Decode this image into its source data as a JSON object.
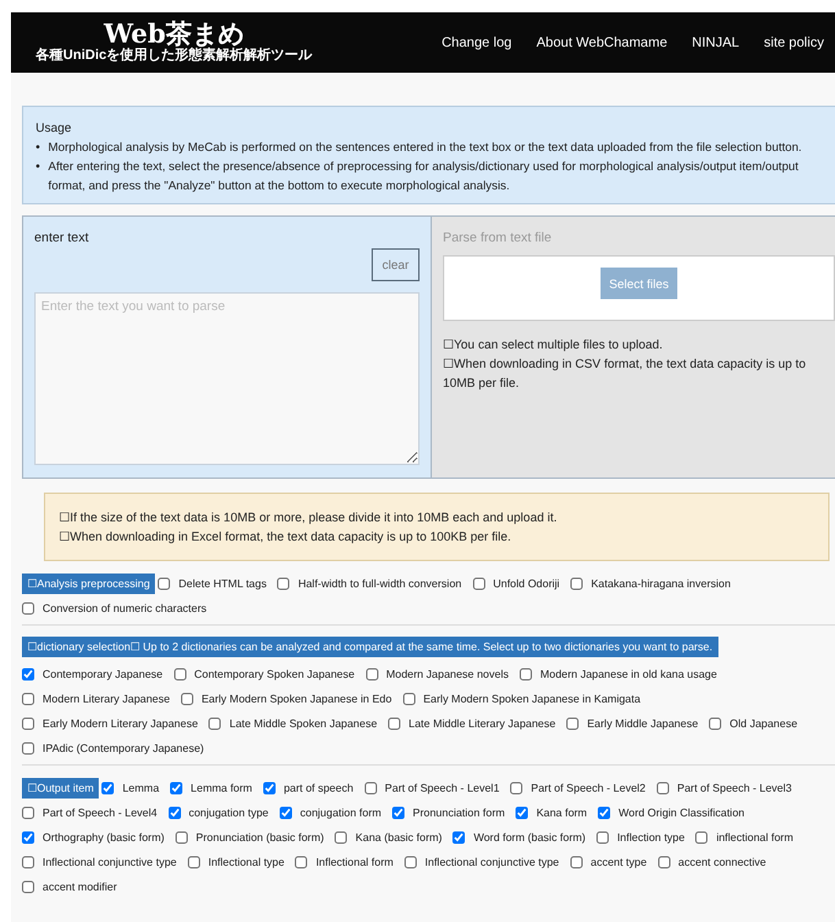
{
  "header": {
    "logo": "Web茶まめ",
    "tagline": "各種UniDicを使用した形態素解析解析ツール",
    "nav": [
      "Change log",
      "About WebChamame",
      "NINJAL",
      "site policy"
    ]
  },
  "usage": {
    "title": "Usage",
    "bullet": "•",
    "items": [
      "Morphological analysis by MeCab is performed on the sentences entered in the text box or the text data uploaded from the file selection button.",
      "After entering the text, select the presence/absence of preprocessing for analysis/dictionary used for morphological analysis/output item/output format, and press the \"Analyze\" button at the bottom to execute morphological analysis."
    ]
  },
  "text_input": {
    "title": "enter text",
    "clear_button": "clear",
    "placeholder": "Enter the text you want to parse"
  },
  "file_input": {
    "title": "Parse from text file",
    "select_button": "Select files",
    "notes": [
      "☐You can select multiple files to upload.",
      "☐When downloading in CSV format, the text data capacity is up to 10MB per file."
    ]
  },
  "notice": [
    "☐If the size of the text data is 10MB or more, please divide it into 10MB each and upload it.",
    "☐When downloading in Excel format, the text data capacity is up to 100KB per file."
  ],
  "sections": [
    {
      "heading": "☐Analysis preprocessing",
      "options": [
        {
          "label": "Delete HTML tags",
          "checked": false
        },
        {
          "label": "Half-width to full-width conversion",
          "checked": false
        },
        {
          "label": "Unfold Odoriji",
          "checked": false
        },
        {
          "label": "Katakana-hiragana inversion",
          "checked": false
        },
        {
          "label": "Conversion of numeric characters",
          "checked": false
        }
      ]
    },
    {
      "heading": "☐dictionary selection☐ Up to 2 dictionaries can be analyzed and compared at the same time. Select up to two dictionaries you want to parse.",
      "options": [
        {
          "label": "Contemporary Japanese",
          "checked": true
        },
        {
          "label": "Contemporary Spoken Japanese",
          "checked": false
        },
        {
          "label": "Modern Japanese novels",
          "checked": false
        },
        {
          "label": "Modern Japanese in old kana usage",
          "checked": false
        },
        {
          "label": "Modern Literary Japanese",
          "checked": false
        },
        {
          "label": "Early Modern Spoken Japanese in Edo",
          "checked": false
        },
        {
          "label": "Early Modern Spoken Japanese in Kamigata",
          "checked": false
        },
        {
          "label": "Early Modern Literary Japanese",
          "checked": false
        },
        {
          "label": "Late Middle Spoken Japanese",
          "checked": false
        },
        {
          "label": "Late Middle Literary Japanese",
          "checked": false
        },
        {
          "label": "Early Middle Japanese",
          "checked": false
        },
        {
          "label": "Old Japanese",
          "checked": false
        },
        {
          "label": "IPAdic (Contemporary Japanese)",
          "checked": false
        }
      ]
    },
    {
      "heading": "☐Output item",
      "options": [
        {
          "label": "Lemma",
          "checked": true
        },
        {
          "label": "Lemma form",
          "checked": true
        },
        {
          "label": "part of speech",
          "checked": true
        },
        {
          "label": "Part of Speech - Level1",
          "checked": false
        },
        {
          "label": "Part of Speech - Level2",
          "checked": false
        },
        {
          "label": "Part of Speech - Level3",
          "checked": false
        },
        {
          "label": "Part of Speech - Level4",
          "checked": false
        },
        {
          "label": "conjugation type",
          "checked": true
        },
        {
          "label": "conjugation form",
          "checked": true
        },
        {
          "label": "Pronunciation form",
          "checked": true
        },
        {
          "label": "Kana form",
          "checked": true
        },
        {
          "label": "Word Origin Classification",
          "checked": true
        },
        {
          "label": "Orthography (basic form)",
          "checked": true
        },
        {
          "label": "Pronunciation (basic form)",
          "checked": false
        },
        {
          "label": "Kana (basic form)",
          "checked": false
        },
        {
          "label": "Word form (basic form)",
          "checked": true
        },
        {
          "label": "Inflection type",
          "checked": false
        },
        {
          "label": "inflectional form",
          "checked": false
        },
        {
          "label": "Inflectional conjunctive type",
          "checked": false
        },
        {
          "label": "Inflectional type",
          "checked": false
        },
        {
          "label": "Inflectional form",
          "checked": false
        },
        {
          "label": "Inflectional conjunctive type",
          "checked": false
        },
        {
          "label": "accent type",
          "checked": false
        },
        {
          "label": "accent connective",
          "checked": false
        },
        {
          "label": "accent modifier",
          "checked": false
        }
      ]
    }
  ]
}
